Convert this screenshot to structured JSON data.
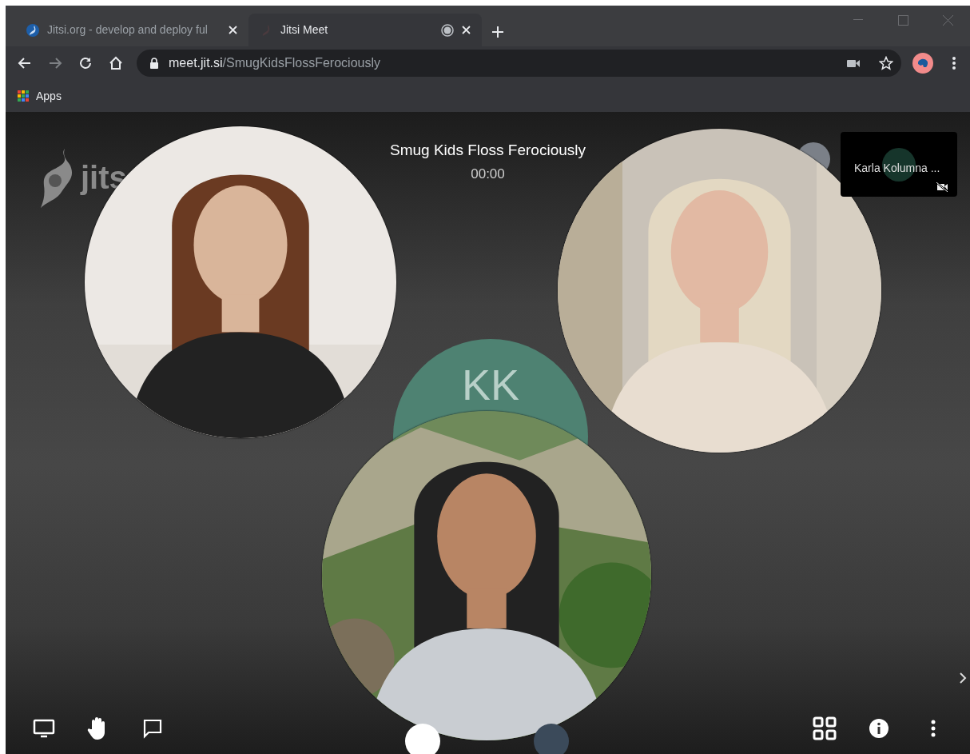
{
  "window": {
    "tabs": [
      {
        "title": "Jitsi.org - develop and deploy ful",
        "selected": false,
        "recording": false
      },
      {
        "title": "Jitsi Meet",
        "selected": true,
        "recording": true
      }
    ]
  },
  "address_bar": {
    "host": "meet.jit.si",
    "path": "/SmugKidsFlossFerociously"
  },
  "bookmarks": [
    "Apps"
  ],
  "meeting": {
    "logo_text": "jits",
    "title": "Smug Kids Floss Ferociously",
    "timer": "00:00",
    "avatar_initials": "KK",
    "remote_tile": {
      "name": "Karla Kolumna ...",
      "video_muted": true
    }
  }
}
